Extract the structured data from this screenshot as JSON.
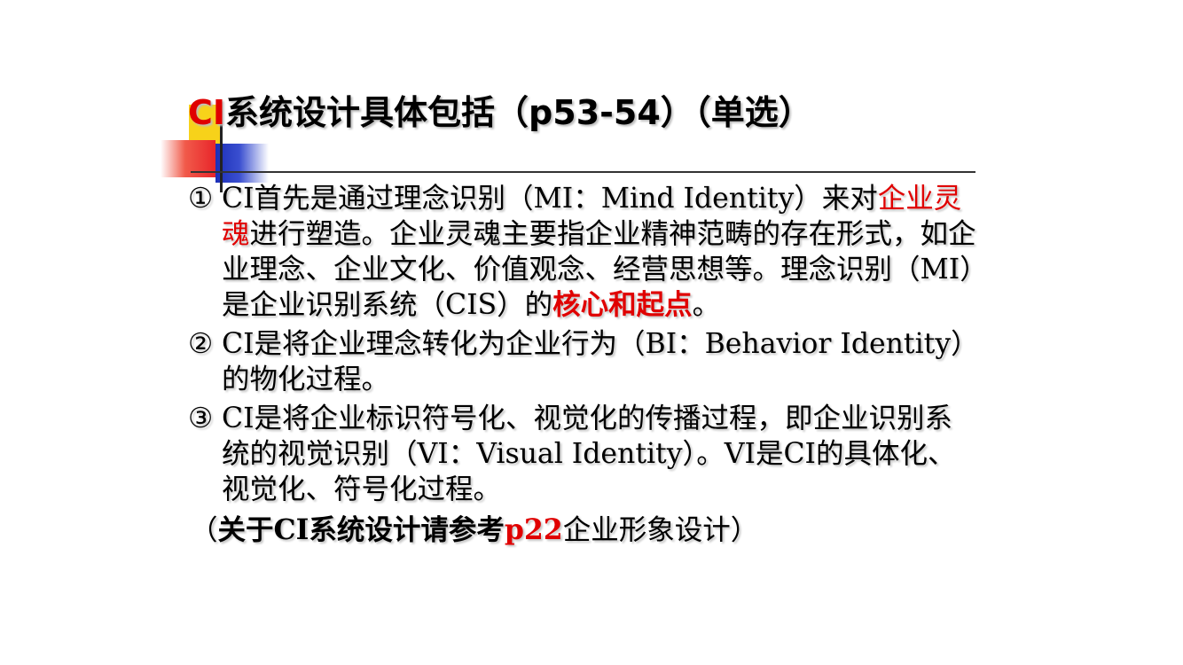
{
  "title": {
    "ci": "CI",
    "main": "系统设计具体包括（",
    "pages": "p53-54",
    "tail": "）（单选）"
  },
  "items": [
    {
      "num": "①",
      "parts": [
        "CI首先是通过理念识别（MI：Mind Identity）来对",
        "企业灵魂",
        "进行塑造。企业灵魂主要指企业精神范畴的存在形式，如企业理念、企业文化、价值观念、经营思想等。理念识别（MI）是企业识别系统（CIS）的",
        "核心和起点",
        "。"
      ]
    },
    {
      "num": "②",
      "text": "CI是将企业理念转化为企业行为（BI：Behavior Identity）的物化过程。"
    },
    {
      "num": "③",
      "text": "CI是将企业标识符号化、视觉化的传播过程，即企业识别系统的视觉识别（VI：Visual Identity）。VI是CI的具体化、视觉化、符号化过程。"
    }
  ],
  "note": {
    "open": "（",
    "prefix": "关于CI系统设计请参考",
    "page": "p22",
    "suffix": "企业形象设计",
    "close": "）"
  },
  "colors": {
    "highlight": "#e00000",
    "text": "#000000",
    "deco_yellow": "#f7d21a",
    "deco_red": "#e8252a",
    "deco_blue": "#1c2fb8"
  }
}
